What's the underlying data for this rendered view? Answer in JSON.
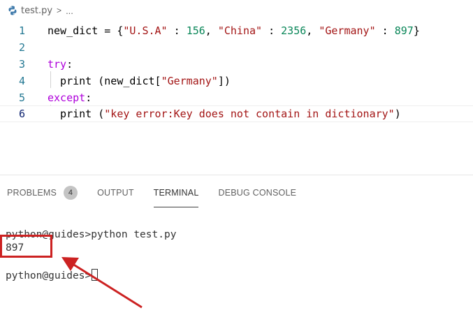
{
  "breadcrumb": {
    "file": "test.py",
    "separator": ">",
    "more": "..."
  },
  "editor": {
    "lines": [
      {
        "num": "1"
      },
      {
        "num": "2"
      },
      {
        "num": "3"
      },
      {
        "num": "4"
      },
      {
        "num": "5"
      },
      {
        "num": "6"
      }
    ],
    "code": {
      "l1_var": "new_dict = {",
      "l1_k1": "\"U.S.A\"",
      "l1_sep1": " : ",
      "l1_v1": "156",
      "l1_c1": ", ",
      "l1_k2": "\"China\"",
      "l1_sep2": " : ",
      "l1_v2": "2356",
      "l1_c2": ", ",
      "l1_k3": "\"Germany\"",
      "l1_sep3": " : ",
      "l1_v3": "897",
      "l1_end": "}",
      "l3_kw": "try",
      "l3_colon": ":",
      "l4_pre": "  print (new_dict[",
      "l4_str": "\"Germany\"",
      "l4_post": "])",
      "l5_kw": "except",
      "l5_colon": ":",
      "l6_pre": "  print (",
      "l6_str": "\"key error:Key does not contain in dictionary\"",
      "l6_post": ")"
    }
  },
  "panel": {
    "tabs": [
      {
        "label": "PROBLEMS",
        "badge": "4"
      },
      {
        "label": "OUTPUT"
      },
      {
        "label": "TERMINAL",
        "active": true
      },
      {
        "label": "DEBUG CONSOLE"
      }
    ]
  },
  "terminal": {
    "line1": "python@guides>python test.py",
    "line2": "897",
    "line3": "python@guides>"
  },
  "colors": {
    "annotation": "#cc2222",
    "string": "#a31515",
    "number": "#098658",
    "keyword": "#0000ff",
    "control": "#af00db"
  },
  "icons": {
    "file": "python-file-icon",
    "chevron": "chevron-right-icon"
  }
}
